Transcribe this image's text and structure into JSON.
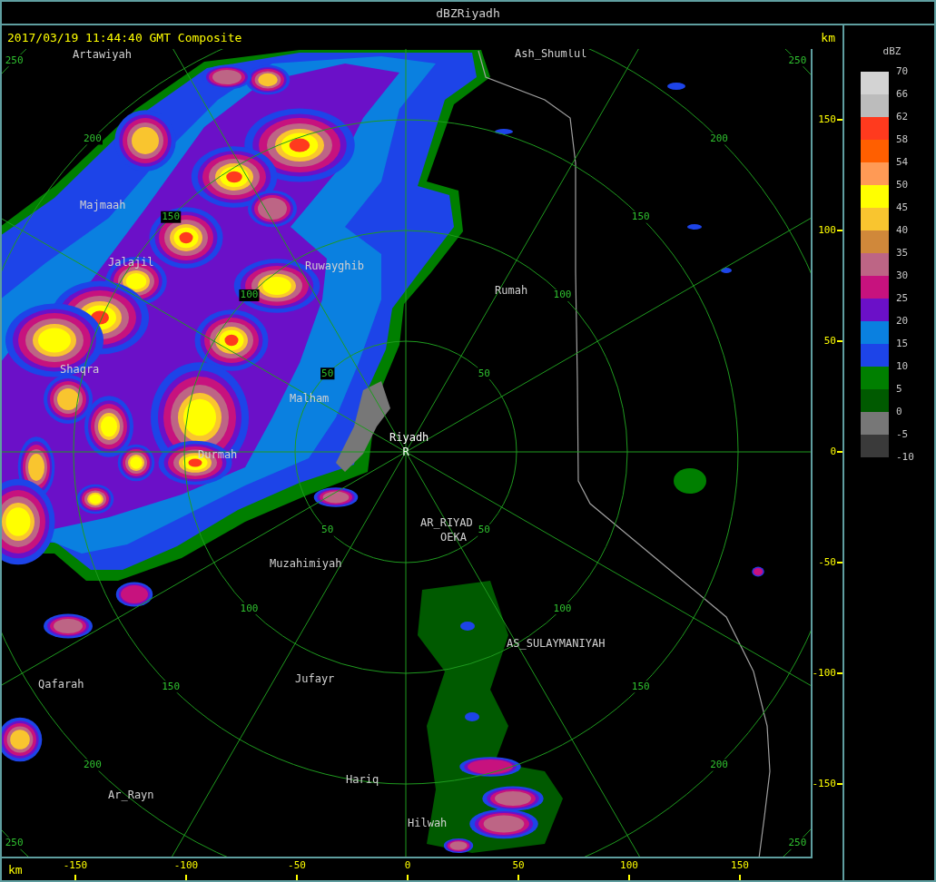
{
  "window": {
    "title": "dBZRiyadh"
  },
  "header": {
    "timestamp": "2017/03/19 11:44:40 GMT Composite",
    "unit": "km"
  },
  "map": {
    "range_rings": [
      {
        "labels": [
          "50",
          "50",
          "50",
          "50"
        ]
      },
      {
        "labels": [
          "100",
          "100",
          "100",
          "100"
        ]
      },
      {
        "labels": [
          "150",
          "150",
          "150",
          "150"
        ]
      },
      {
        "labels": [
          "200",
          "200",
          "200",
          "200"
        ]
      },
      {
        "labels": [
          "250",
          "250",
          "250",
          "250"
        ]
      }
    ],
    "places": [
      {
        "name": "Artawiyah"
      },
      {
        "name": "Ash_Shumlul"
      },
      {
        "name": "Majmaah"
      },
      {
        "name": "Jalajil"
      },
      {
        "name": "Ruwayghib"
      },
      {
        "name": "Rumah"
      },
      {
        "name": "Shaqra"
      },
      {
        "name": "Malham"
      },
      {
        "name": "Durmah"
      },
      {
        "name": "AR_RIYAD"
      },
      {
        "name": "OEKA"
      },
      {
        "name": "Muzahimiyah"
      },
      {
        "name": "AS_SULAYMANIYAH"
      },
      {
        "name": "Qafarah"
      },
      {
        "name": "Jufayr"
      },
      {
        "name": "Hariq"
      },
      {
        "name": "Ar_Rayn"
      },
      {
        "name": "Hilwah"
      }
    ],
    "radar_site": {
      "name": "Riyadh",
      "marker": "R"
    }
  },
  "y_axis": {
    "ticks": [
      "150",
      "100",
      "50",
      "0",
      "-50",
      "-100",
      "-150"
    ]
  },
  "x_axis": {
    "unit": "km",
    "ticks": [
      "-150",
      "-100",
      "-50",
      "0",
      "50",
      "100",
      "150"
    ]
  },
  "legend": {
    "unit": "dBZ",
    "bins": [
      {
        "label": "70",
        "color": "#d3d3d3"
      },
      {
        "label": "66",
        "color": "#bcbcbc"
      },
      {
        "label": "62",
        "color": "#ff3a1e"
      },
      {
        "label": "58",
        "color": "#ff5f00"
      },
      {
        "label": "54",
        "color": "#ff9a55"
      },
      {
        "label": "50",
        "color": "#ffff00"
      },
      {
        "label": "45",
        "color": "#f9c52f"
      },
      {
        "label": "40",
        "color": "#d0883a"
      },
      {
        "label": "35",
        "color": "#bd6585"
      },
      {
        "label": "30",
        "color": "#c7127e"
      },
      {
        "label": "25",
        "color": "#6b10c8"
      },
      {
        "label": "20",
        "color": "#0a80e0"
      },
      {
        "label": "15",
        "color": "#1d44e8"
      },
      {
        "label": "10",
        "color": "#007f00"
      },
      {
        "label": "5",
        "color": "#005a00"
      },
      {
        "label": "0",
        "color": "#777777"
      },
      {
        "label": "-5",
        "color": "#3a3a3a"
      }
    ],
    "end_label": "-10"
  }
}
